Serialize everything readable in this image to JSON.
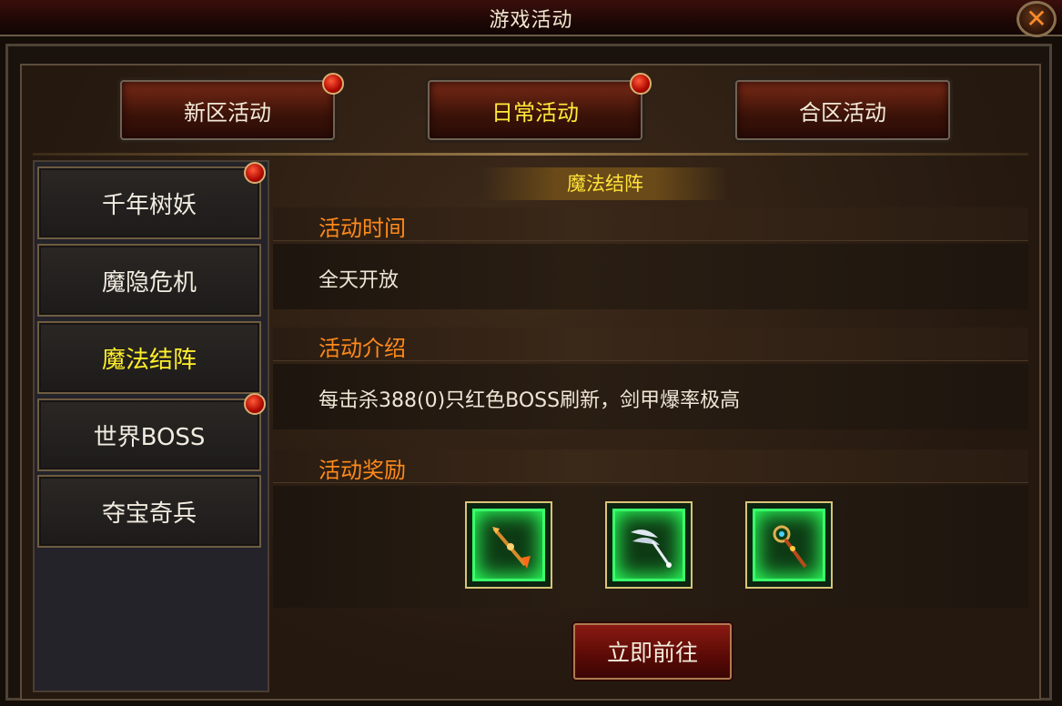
{
  "window": {
    "title": "游戏活动",
    "close_label": "✕"
  },
  "top_tabs": [
    {
      "label": "新区活动",
      "has_alert": true
    },
    {
      "label": "日常活动",
      "has_alert": true,
      "active": true
    },
    {
      "label": "合区活动",
      "has_alert": false
    }
  ],
  "sidebar": {
    "items": [
      {
        "label": "千年树妖",
        "has_alert": true
      },
      {
        "label": "魔隐危机",
        "has_alert": false
      },
      {
        "label": "魔法结阵",
        "has_alert": false,
        "active": true
      },
      {
        "label": "世界BOSS",
        "has_alert": true
      },
      {
        "label": "夺宝奇兵",
        "has_alert": false
      }
    ]
  },
  "activity": {
    "title": "魔法结阵",
    "time_header": "活动时间",
    "time_text": "全天开放",
    "intro_header": "活动介绍",
    "intro_text": "每击杀388(0)只红色BOSS刷新，剑甲爆率极高",
    "reward_header": "活动奖励",
    "rewards": [
      {
        "icon": "fire-spear-icon"
      },
      {
        "icon": "winged-staff-icon"
      },
      {
        "icon": "jeweled-scepter-icon"
      }
    ],
    "go_button": "立即前往"
  },
  "colors": {
    "accent_yellow": "#ffea3a",
    "section_orange": "#ff8a1a",
    "alert_red": "#d01000",
    "reward_glow": "#39ff6a"
  }
}
